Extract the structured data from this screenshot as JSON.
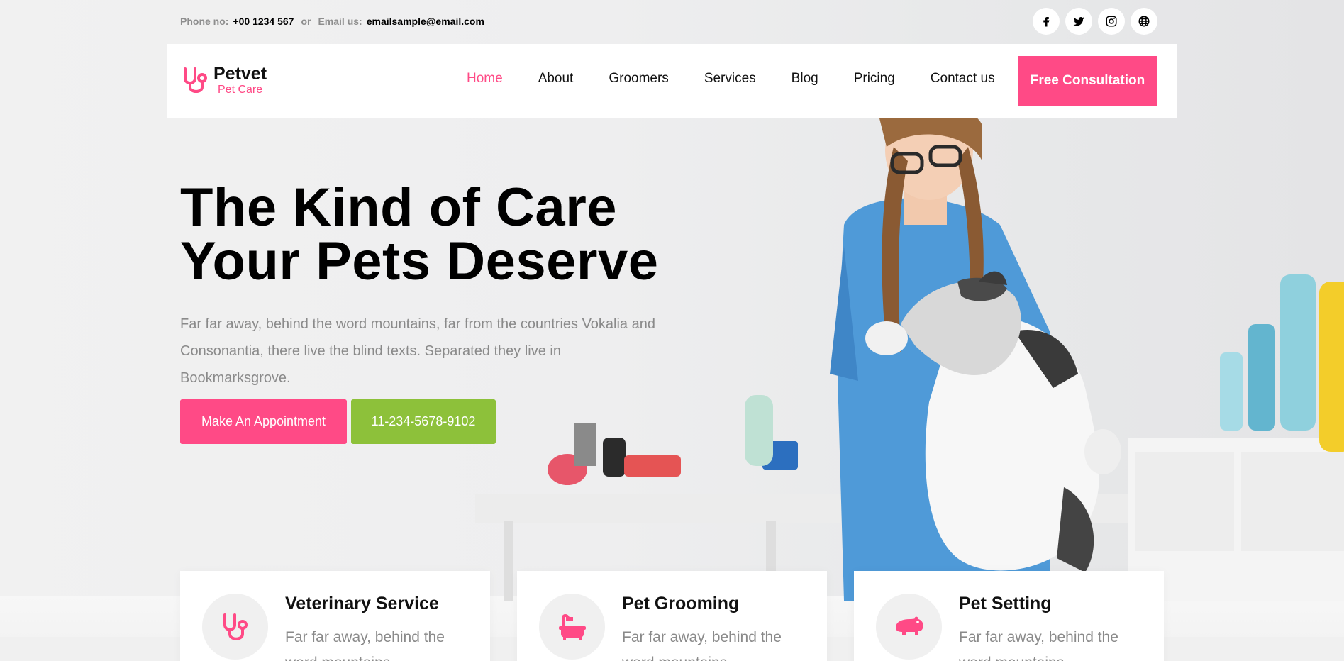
{
  "topbar": {
    "phone_label": "Phone no:",
    "phone_value": "+00 1234 567",
    "or_text": "or",
    "email_label": "Email us:",
    "email_value": "emailsample@email.com"
  },
  "socials": [
    {
      "icon": "facebook-icon"
    },
    {
      "icon": "twitter-icon"
    },
    {
      "icon": "instagram-icon"
    },
    {
      "icon": "globe-icon"
    }
  ],
  "brand": {
    "name": "Petvet",
    "tagline": "Pet Care",
    "accent": "#ff4a86"
  },
  "nav": {
    "items": [
      {
        "label": "Home",
        "active": true
      },
      {
        "label": "About"
      },
      {
        "label": "Groomers"
      },
      {
        "label": "Services"
      },
      {
        "label": "Blog"
      },
      {
        "label": "Pricing"
      },
      {
        "label": "Contact us"
      }
    ],
    "cta_label": "Free Consultation"
  },
  "hero": {
    "headline_line1": "The Kind of Care",
    "headline_line2": "Your Pets Deserve",
    "text": "Far far away, behind the word mountains, far from the countries Vokalia and Consonantia, there live the blind texts. Separated they live in Bookmarksgrove.",
    "primary_button": "Make An Appointment",
    "secondary_button": "11-234-5678-9102",
    "primary_color": "#ff4a86",
    "secondary_color": "#8dc13a"
  },
  "services": [
    {
      "icon": "stethoscope-icon",
      "title": "Veterinary Service",
      "text": "Far far away, behind the word mountains"
    },
    {
      "icon": "bathtub-icon",
      "title": "Pet Grooming",
      "text": "Far far away, behind the word mountains"
    },
    {
      "icon": "hippo-icon",
      "title": "Pet Setting",
      "text": "Far far away, behind the word mountains"
    }
  ]
}
